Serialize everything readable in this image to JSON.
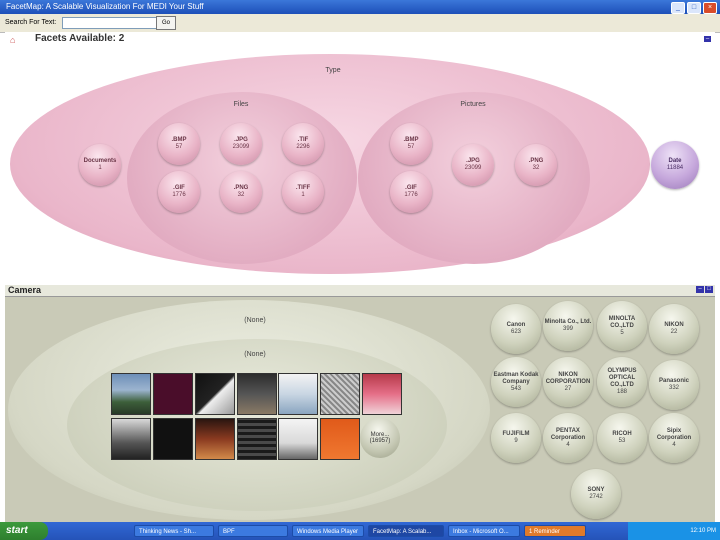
{
  "window": {
    "title": "FacetMap: A Scalable Visualization For MEDI Your Stuff"
  },
  "search": {
    "label": "Search For Text:",
    "value": "",
    "go": "Go"
  },
  "facets": {
    "title": "Facets Available: 2",
    "type_label": "Type",
    "files_label": "Files",
    "pictures_label": "Pictures",
    "documents": {
      "name": "Documents",
      "count": "1"
    },
    "date": {
      "name": "Date",
      "count": "11884"
    },
    "files": [
      {
        "name": ".BMP",
        "count": "57"
      },
      {
        "name": ".JPG",
        "count": "23099"
      },
      {
        "name": ".TIF",
        "count": "2296"
      },
      {
        "name": ".GIF",
        "count": "1776"
      },
      {
        "name": ".PNG",
        "count": "32"
      },
      {
        "name": ".TIFF",
        "count": "1"
      }
    ],
    "pictures": [
      {
        "name": ".BMP",
        "count": "57"
      },
      {
        "name": ".JPG",
        "count": "23099"
      },
      {
        "name": ".PNG",
        "count": "32"
      },
      {
        "name": ".GIF",
        "count": "1776"
      }
    ]
  },
  "camera": {
    "title": "Camera",
    "outer_label": "(None)",
    "inner_label": "(None)",
    "more": {
      "name": "More...",
      "count": "(16957)"
    },
    "makers": [
      {
        "name": "Canon",
        "count": "623"
      },
      {
        "name": "Minolta Co., Ltd.",
        "count": "399"
      },
      {
        "name": "MINOLTA CO.,LTD",
        "count": "5"
      },
      {
        "name": "NIKON",
        "count": "22"
      },
      {
        "name": "Eastman Kodak Company",
        "count": "543"
      },
      {
        "name": "NIKON CORPORATION",
        "count": "27"
      },
      {
        "name": "OLYMPUS OPTICAL CO.,LTD",
        "count": "188"
      },
      {
        "name": "Panasonic",
        "count": "332"
      },
      {
        "name": "FUJIFILM",
        "count": "9"
      },
      {
        "name": "PENTAX Corporation",
        "count": "4"
      },
      {
        "name": "RICOH",
        "count": "53"
      },
      {
        "name": "Sipix Corporation",
        "count": "4"
      },
      {
        "name": "SONY",
        "count": "2742"
      }
    ]
  },
  "taskbar": {
    "start": "start",
    "items": [
      "Thinking News - Sh...",
      "BPF",
      "Windows Media Player",
      "FacetMap: A Scalab...",
      "Inbox - Microsoft O...",
      "1 Reminder"
    ],
    "time": "12:10 PM"
  },
  "colors": {
    "pink": "#e9b4c7",
    "purple": "#c6a8dc",
    "sage": "#c9cab7",
    "taskbar": "#2553b8"
  }
}
